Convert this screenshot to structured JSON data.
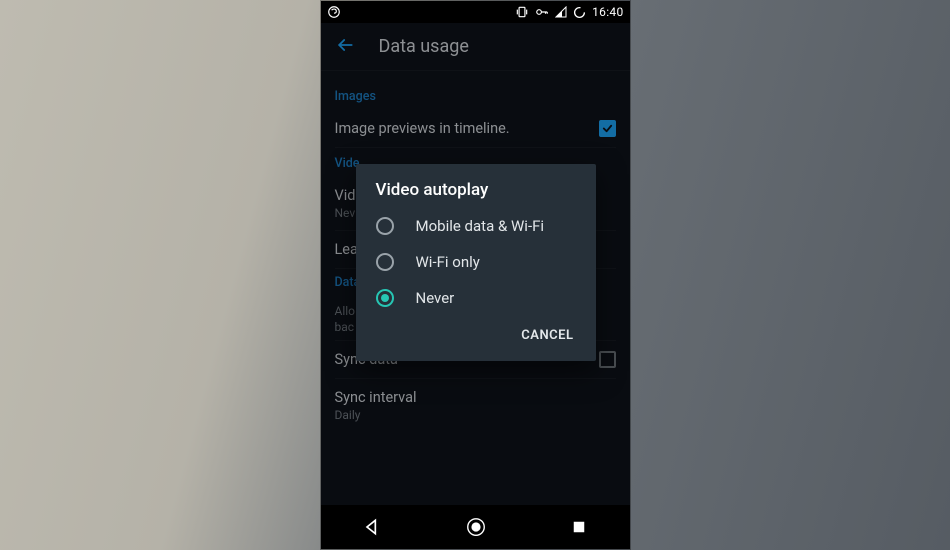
{
  "statusbar": {
    "time": "16:40"
  },
  "appbar": {
    "title": "Data usage"
  },
  "sections": {
    "images": {
      "header": "Images",
      "row1_label": "Image previews in timeline."
    },
    "video": {
      "header": "Vide",
      "row1_label": "Vid",
      "row1_sub": "Nev",
      "row2_label": "Lea"
    },
    "data": {
      "header": "Data",
      "row1_label": "Allo",
      "row1_sub": "bac",
      "row2_label": "Sync data",
      "row3_label": "Sync interval",
      "row3_sub": "Daily"
    }
  },
  "dialog": {
    "title": "Video autoplay",
    "options": {
      "opt1": "Mobile data & Wi-Fi",
      "opt2": "Wi-Fi only",
      "opt3": "Never"
    },
    "cancel": "CANCEL"
  }
}
